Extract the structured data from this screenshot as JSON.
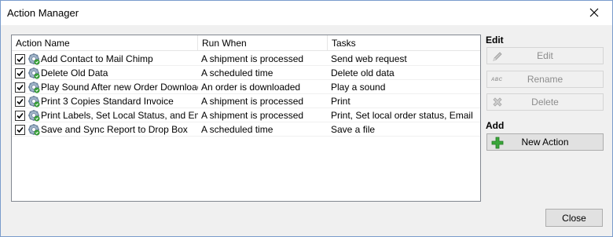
{
  "window": {
    "title": "Action Manager",
    "close_glyph": "close-icon"
  },
  "table": {
    "headers": [
      "Action Name",
      "Run When",
      "Tasks"
    ],
    "rows": [
      {
        "checked": true,
        "name": "Add Contact to Mail Chimp",
        "run_when": "A shipment is processed",
        "tasks": "Send web request"
      },
      {
        "checked": true,
        "name": "Delete Old Data",
        "run_when": "A scheduled time",
        "tasks": "Delete old data"
      },
      {
        "checked": true,
        "name": "Play Sound After new Order Downloaded",
        "run_when": "An order is downloaded",
        "tasks": "Play a sound"
      },
      {
        "checked": true,
        "name": "Print 3 Copies Standard Invoice",
        "run_when": "A shipment is processed",
        "tasks": "Print"
      },
      {
        "checked": true,
        "name": "Print Labels, Set Local Status, and Email",
        "run_when": "A shipment is processed",
        "tasks": "Print, Set local order status, Email"
      },
      {
        "checked": true,
        "name": "Save and Sync Report to Drop Box",
        "run_when": "A scheduled time",
        "tasks": "Save a file"
      }
    ]
  },
  "side": {
    "edit_label": "Edit",
    "edit_button": "Edit",
    "rename_button": "Rename",
    "rename_icon_text": "ABC",
    "delete_button": "Delete",
    "add_label": "Add",
    "new_action_button": "New Action"
  },
  "footer": {
    "close_button": "Close"
  },
  "colors": {
    "accent_green": "#3aa63a",
    "disabled_text": "#8d8d8d",
    "window_border": "#7a9ccc"
  }
}
